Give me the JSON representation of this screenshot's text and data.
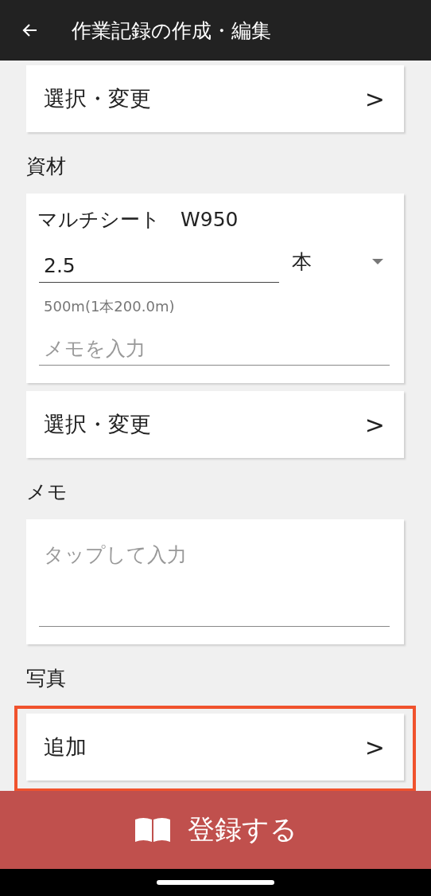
{
  "app_bar": {
    "title": "作業記録の作成・編集"
  },
  "sections": [
    {
      "kind": "select",
      "action": "選択・変更",
      "chevron": ">",
      "highlighted": false
    },
    {
      "kind": "material",
      "label": "資材",
      "name": "マルチシート　W950",
      "quantity": "2.5",
      "unit": "本",
      "hint": "500m(1本200.0m)",
      "memo_placeholder": "メモを入力"
    },
    {
      "kind": "select",
      "action": "選択・変更",
      "chevron": ">",
      "highlighted": false
    },
    {
      "kind": "memo",
      "label": "メモ",
      "placeholder": "タップして入力"
    },
    {
      "kind": "select",
      "label": "写真",
      "action": "追加",
      "chevron": ">",
      "highlighted": true
    }
  ],
  "submit_button": {
    "label": "登録する"
  }
}
